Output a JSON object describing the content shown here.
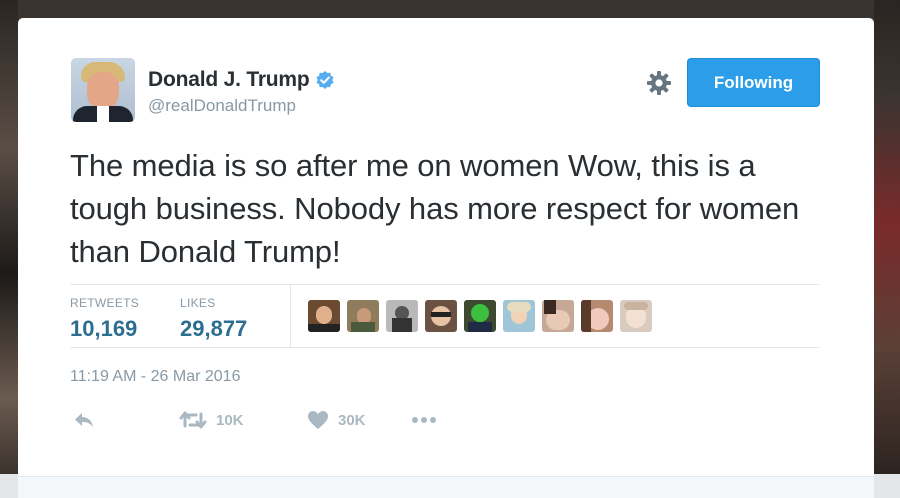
{
  "tweet": {
    "author": {
      "display_name": "Donald J. Trump",
      "handle": "@realDonaldTrump",
      "verified": true
    },
    "follow_button_label": "Following",
    "text": "The media is so after me on women  Wow, this is a tough business. Nobody has more respect for women than Donald Trump!",
    "stats": {
      "retweets_label": "RETWEETS",
      "retweets_value": "10,169",
      "likes_label": "LIKES",
      "likes_value": "29,877"
    },
    "timestamp": "11:19 AM - 26 Mar 2016",
    "actions": {
      "retweet_count": "10K",
      "like_count": "30K"
    },
    "liker_avatars": 9
  },
  "colors": {
    "accent": "#2b9de9",
    "stat_value": "#2c6e8f",
    "muted": "#8899a6",
    "text": "#292f33",
    "verified": "#55acee"
  }
}
